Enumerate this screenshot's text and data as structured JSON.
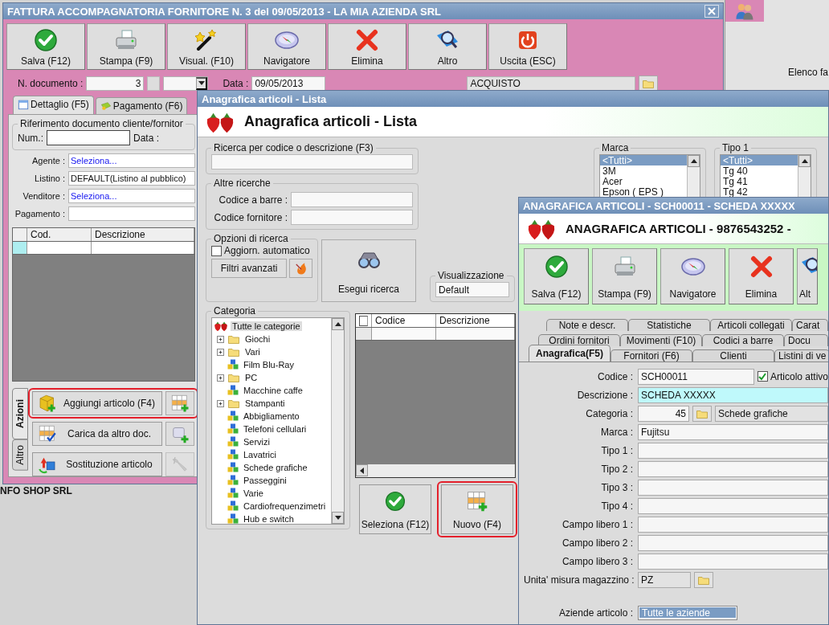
{
  "desktop": {
    "status_text": "NFO SHOP SRL",
    "background_button": "Elenco fa"
  },
  "invoice_window": {
    "title": "FATTURA ACCOMPAGNATORIA FORNITORE N. 3 del 09/05/2013 - LA MIA AZIENDA SRL",
    "toolbar": [
      "Salva (F12)",
      "Stampa (F9)",
      "Visual. (F10)",
      "Navigatore",
      "Elimina",
      "Altro",
      "Uscita (ESC)"
    ],
    "doc_number": {
      "label": "N. documento :",
      "value": "3"
    },
    "date": {
      "label": "Data :",
      "value": "09/05/2013"
    },
    "causale": {
      "value": "ACQUISTO"
    },
    "tabs": [
      {
        "label": "Dettaglio (F5)",
        "selected": true
      },
      {
        "label": "Pagamento (F6)",
        "selected": false
      }
    ],
    "reference": {
      "legend": "Riferimento documento cliente/fornitor",
      "num_label": "Num.:",
      "date_label": "Data :"
    },
    "fields": [
      {
        "label": "Agente :",
        "value": "Seleziona...",
        "kind": "prompt"
      },
      {
        "label": "Listino :",
        "value": "DEFAULT(Listino al pubblico)",
        "kind": "text"
      },
      {
        "label": "Venditore :",
        "value": "Seleziona...",
        "kind": "prompt"
      },
      {
        "label": "Pagamento :",
        "kind": "text"
      }
    ],
    "grid": {
      "columns": [
        "Cod.",
        "Descrizione"
      ]
    },
    "side_tabs": [
      {
        "label": "Azioni",
        "selected": true
      },
      {
        "label": "Altro",
        "selected": false
      }
    ],
    "actions": [
      {
        "label": "Aggiungi articolo (F4)",
        "highlighted": true
      },
      {
        "label": "Carica da altro doc.",
        "highlighted": false
      },
      {
        "label": "Sostituzione articolo",
        "highlighted": false
      }
    ]
  },
  "list_window": {
    "title": "Anagrafica articoli  - Lista",
    "heading": "Anagrafica articoli  - Lista",
    "search": {
      "legend": "Ricerca per codice o descrizione (F3)"
    },
    "other_searches": {
      "legend": "Altre ricerche",
      "fields": [
        "Codice a barre :",
        "Codice fornitore :"
      ]
    },
    "options": {
      "legend": "Opzioni di ricerca",
      "checkbox": {
        "label": "Aggiorn. automatico",
        "checked": false
      },
      "filters_button": "Filtri avanzati"
    },
    "search_button": "Esegui ricerca",
    "view": {
      "legend": "Visualizzazione",
      "value": "Default"
    },
    "brand": {
      "legend": "Marca",
      "items": [
        {
          "label": "<Tutti>",
          "selected": true
        },
        {
          "label": "3M",
          "selected": false
        },
        {
          "label": "Acer",
          "selected": false
        },
        {
          "label": "Epson ( EPS )",
          "selected": false
        }
      ]
    },
    "type1": {
      "legend": "Tipo 1",
      "items": [
        {
          "label": "<Tutti>",
          "selected": true
        },
        {
          "label": "Tg 40",
          "selected": false
        },
        {
          "label": "Tg 41",
          "selected": false
        },
        {
          "label": "Tg 42",
          "selected": false
        }
      ]
    },
    "category": {
      "legend": "Categoria",
      "root": {
        "label": "Tutte le categorie",
        "selected": true
      },
      "items": [
        {
          "label": "Giochi",
          "kind": "folder"
        },
        {
          "label": "Vari",
          "kind": "folder"
        },
        {
          "label": "Film Blu-Ray",
          "kind": "category"
        },
        {
          "label": "PC",
          "kind": "folder"
        },
        {
          "label": "Macchine caffe",
          "kind": "category"
        },
        {
          "label": "Stampanti",
          "kind": "folder"
        },
        {
          "label": "Abbigliamento",
          "kind": "category"
        },
        {
          "label": "Telefoni cellulari",
          "kind": "category"
        },
        {
          "label": "Servizi",
          "kind": "category"
        },
        {
          "label": "Lavatrici",
          "kind": "category"
        },
        {
          "label": "Schede grafiche",
          "kind": "category"
        },
        {
          "label": "Passeggini",
          "kind": "category"
        },
        {
          "label": "Varie",
          "kind": "category"
        },
        {
          "label": "Cardiofrequenzimetri",
          "kind": "category"
        },
        {
          "label": "Hub e switch",
          "kind": "category"
        }
      ]
    },
    "grid": {
      "columns": [
        "Codice",
        "Descrizione"
      ],
      "checked": false
    },
    "buttons": [
      {
        "label": "Seleziona (F12)",
        "highlighted": false
      },
      {
        "label": "Nuovo (F4)",
        "highlighted": true
      }
    ]
  },
  "detail_window": {
    "title": "ANAGRAFICA ARTICOLI - SCH00011 - SCHEDA XXXXX",
    "heading": "ANAGRAFICA ARTICOLI - 9876543252 -",
    "toolbar": [
      "Salva (F12)",
      "Stampa (F9)",
      "Navigatore",
      "Elimina",
      "Alt"
    ],
    "tab_rows": [
      [
        {
          "label": "Note e descr.",
          "selected": false
        },
        {
          "label": "Statistiche",
          "selected": false
        },
        {
          "label": "Articoli collegati",
          "selected": false
        },
        {
          "label": "Carat",
          "selected": false
        }
      ],
      [
        {
          "label": "Ordini fornitori",
          "selected": false
        },
        {
          "label": "Movimenti (F10)",
          "selected": false
        },
        {
          "label": "Codici a barre",
          "selected": false
        },
        {
          "label": "Docu",
          "selected": false
        }
      ],
      [
        {
          "label": "Anagrafica(F5)",
          "selected": true
        },
        {
          "label": "Fornitori (F6)",
          "selected": false
        },
        {
          "label": "Clienti",
          "selected": false
        },
        {
          "label": "Listini di ve",
          "selected": false
        }
      ]
    ],
    "code": {
      "label": "Codice :",
      "value": "SCH00011",
      "checkbox": {
        "label": "Articolo attivo",
        "checked": true
      }
    },
    "description": {
      "label": "Descrizione :",
      "value": "SCHEDA XXXXX"
    },
    "category": {
      "label": "Categoria :",
      "code": "45",
      "name": "Schede grafiche"
    },
    "brand": {
      "label": "Marca :",
      "value": "Fujitsu"
    },
    "free_fields": [
      "Tipo 1 :",
      "Tipo 2 :",
      "Tipo 3 :",
      "Tipo 4 :",
      "Campo libero 1 :",
      "Campo libero 2 :",
      "Campo libero 3 :"
    ],
    "unit": {
      "label": "Unita' misura magazzino :",
      "value": "PZ"
    },
    "companies": {
      "label": "Aziende articolo :",
      "items": [
        {
          "label": "Tutte le aziende",
          "selected": true
        }
      ]
    }
  }
}
